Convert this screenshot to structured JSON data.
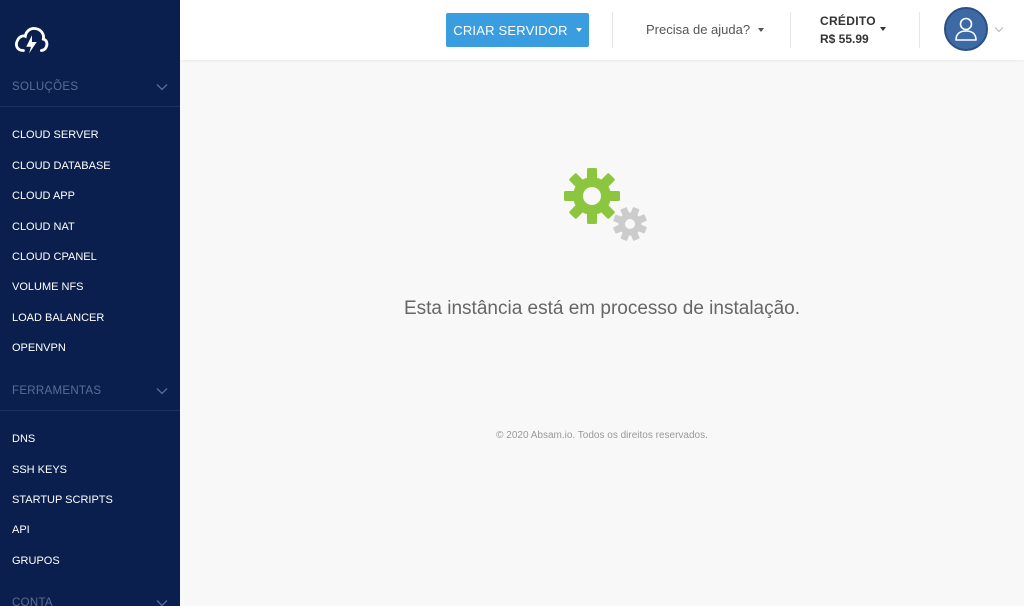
{
  "sidebar": {
    "logo_name": "cloud-logo",
    "sections": [
      {
        "title": "SOLUÇÕES"
      },
      {
        "title": "FERRAMENTAS"
      },
      {
        "title": "CONTA"
      }
    ],
    "solucoes_items": [
      {
        "label": "CLOUD SERVER"
      },
      {
        "label": "CLOUD DATABASE"
      },
      {
        "label": "CLOUD APP"
      },
      {
        "label": "CLOUD NAT"
      },
      {
        "label": "CLOUD CPANEL"
      },
      {
        "label": "VOLUME NFS"
      },
      {
        "label": "LOAD BALANCER"
      },
      {
        "label": "OPENVPN"
      }
    ],
    "ferramentas_items": [
      {
        "label": "DNS"
      },
      {
        "label": "SSH KEYS"
      },
      {
        "label": "STARTUP SCRIPTS"
      },
      {
        "label": "API"
      },
      {
        "label": "GRUPOS"
      }
    ]
  },
  "header": {
    "create_button_label": "CRIAR SERVIDOR",
    "help_label": "Precisa de ajuda?",
    "credit_label": "CRÉDITO",
    "credit_value": "R$ 55.99"
  },
  "main": {
    "message": "Esta instância está em processo de instalação.",
    "footer": "© 2020 Absam.io. Todos os direitos reservados."
  },
  "colors": {
    "sidebar_bg": "#0a1f4d",
    "accent": "#3a9de0",
    "gear_green": "#8cc63f",
    "gear_gray": "#cccccc",
    "avatar": "#3d6aa4"
  }
}
